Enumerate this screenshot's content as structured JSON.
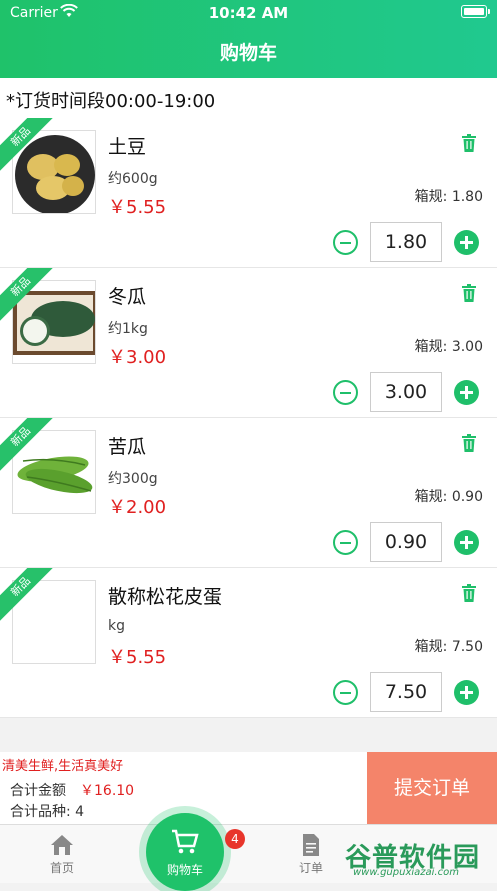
{
  "status_bar": {
    "carrier": "Carrier",
    "time": "10:42 AM"
  },
  "header": {
    "title": "购物车"
  },
  "notice": "*订货时间段00:00-19:00",
  "items": [
    {
      "badge": "新品",
      "name": "土豆",
      "weight": "约600g",
      "price": "￥5.55",
      "spec": "箱规: 1.80",
      "qty": "1.80",
      "image": "potato"
    },
    {
      "badge": "新品",
      "name": "冬瓜",
      "weight": "约1kg",
      "price": "￥3.00",
      "spec": "箱规: 3.00",
      "qty": "3.00",
      "image": "wax-gourd"
    },
    {
      "badge": "新品",
      "name": "苦瓜",
      "weight": "约300g",
      "price": "￥2.00",
      "spec": "箱规: 0.90",
      "qty": "0.90",
      "image": "bitter-melon"
    },
    {
      "badge": "新品",
      "name": "散称松花皮蛋",
      "weight": "kg",
      "price": "￥5.55",
      "spec": "箱规: 7.50",
      "qty": "7.50",
      "image": ""
    }
  ],
  "summary": {
    "slogan": "清美生鲜,生活真美好",
    "total_label": "合计金额",
    "total_value": "￥16.10",
    "kinds": "合计品种:  4",
    "submit": "提交订单"
  },
  "tabbar": {
    "home": "首页",
    "cart": "购物车",
    "cart_badge": "4",
    "order": "订单"
  },
  "watermark": {
    "text": "谷普软件园",
    "url": "www.gupuxiazai.com"
  },
  "colors": {
    "brand_green": "#1fc26a",
    "price_red": "#e02020",
    "submit_orange": "#f4846a"
  }
}
